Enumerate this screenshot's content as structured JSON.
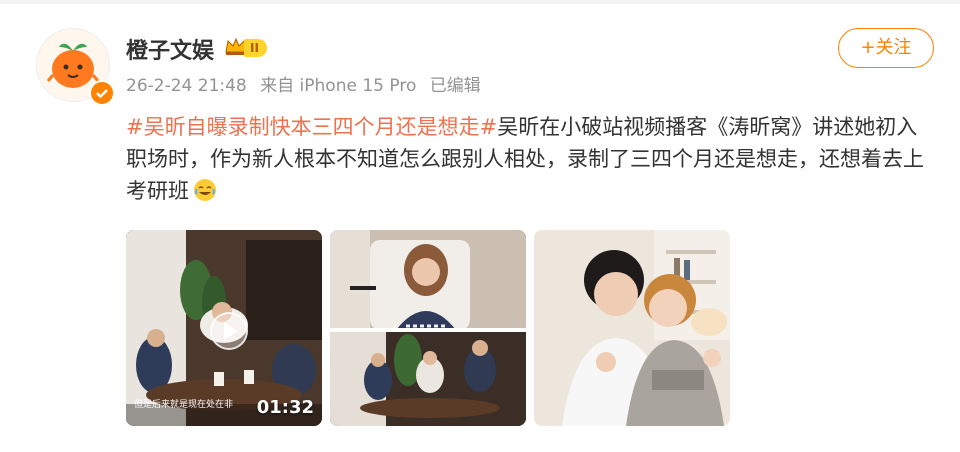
{
  "post": {
    "username": "橙子文娱",
    "level_badge": "II",
    "date": "26-2-24 21:48",
    "source": "来自 iPhone 15 Pro",
    "edited": "已编辑",
    "follow_label": "+关注",
    "topic": "#吴昕自曝录制快本三四个月还是想走#",
    "body": "吴昕在小破站视频播客《涛昕窝》讲述她初入职场时，作为新人根本不知道怎么跟别人相处，录制了三四个月还是想走，还想着去上考研班",
    "video_duration": "01:32",
    "video_subtitle": "但是后来就是现在处在非",
    "colors": {
      "accent": "#ff8200",
      "topic": "#eb7350",
      "meta": "#939393"
    }
  }
}
